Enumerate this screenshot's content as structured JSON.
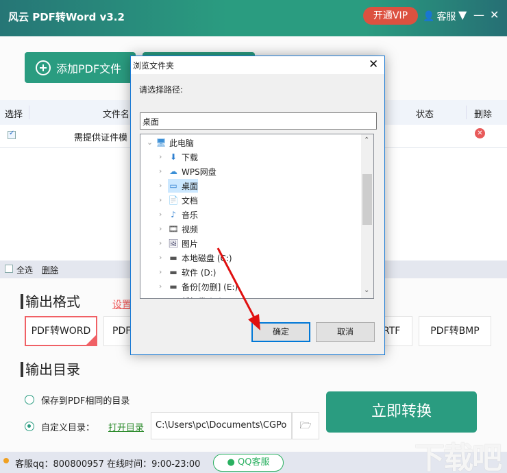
{
  "app": {
    "title": "风云 PDF转Word v3.2",
    "vip_label": "开通VIP",
    "service_label": "客服",
    "icons": {
      "user": "user-icon",
      "menu": "menu-icon",
      "minimize": "minimize-icon",
      "close": "close-icon"
    }
  },
  "toolbar": {
    "add_pdf_label": "添加PDF文件"
  },
  "table": {
    "headers": {
      "select": "选择",
      "filename": "文件名",
      "status": "状态",
      "delete": "删除"
    },
    "rows": [
      {
        "checked": true,
        "filename": "需提供证件模",
        "status": ""
      }
    ],
    "footer": {
      "select_all": "全选",
      "delete": "删除"
    }
  },
  "output_format": {
    "title": "输出格式",
    "settings_link": "设置",
    "options": [
      "PDF转WORD",
      "PDF",
      "RTF",
      "PDF转BMP"
    ],
    "selected": "PDF转WORD"
  },
  "output_dir": {
    "title": "输出目录",
    "option_same": "保存到PDF相同的目录",
    "option_custom": "自定义目录：",
    "selected": "custom",
    "open_dir_link": "打开目录",
    "path_value": "C:\\Users\\pc\\Documents\\CGPo"
  },
  "convert_label": "立即转换",
  "status_bar": {
    "text": "客服qq：800800957 在线时间：9:00-23:00",
    "qq_button": "QQ客服"
  },
  "watermark": "下载吧",
  "dialog": {
    "title": "浏览文件夹",
    "prompt": "请选择路径:",
    "path_value": "桌面",
    "tree": [
      {
        "label": "此电脑",
        "icon": "computer-icon",
        "expanded": true,
        "level": 0
      },
      {
        "label": "下载",
        "icon": "download-icon",
        "level": 1
      },
      {
        "label": "WPS网盘",
        "icon": "cloud-icon",
        "level": 1
      },
      {
        "label": "桌面",
        "icon": "desktop-icon",
        "level": 1,
        "selected": true
      },
      {
        "label": "文档",
        "icon": "document-icon",
        "level": 1
      },
      {
        "label": "音乐",
        "icon": "music-icon",
        "level": 1
      },
      {
        "label": "视频",
        "icon": "video-icon",
        "level": 1
      },
      {
        "label": "图片",
        "icon": "picture-icon",
        "level": 1
      },
      {
        "label": "本地磁盘 (C:)",
        "icon": "drive-icon",
        "level": 1
      },
      {
        "label": "软件 (D:)",
        "icon": "drive-icon",
        "level": 1
      },
      {
        "label": "备份[勿删] (E:)",
        "icon": "drive-icon",
        "level": 1
      },
      {
        "label": "新加卷 (F:)",
        "icon": "drive-icon",
        "level": 1
      }
    ],
    "ok_label": "确定",
    "cancel_label": "取消"
  },
  "colors": {
    "brand": "#2a9c80",
    "vip": "#dc5140",
    "accent_red": "#f06065",
    "link_green": "#2a8a2a"
  }
}
